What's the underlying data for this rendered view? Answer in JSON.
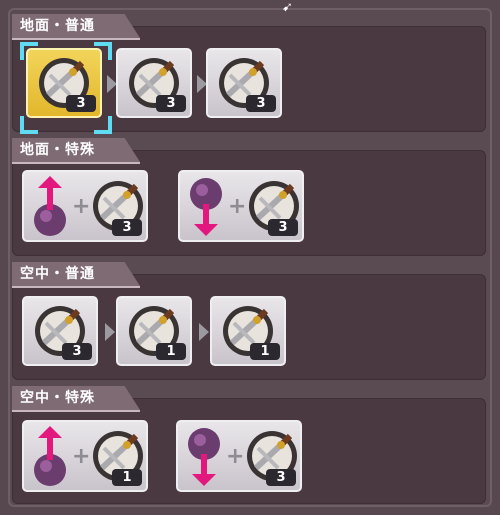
{
  "sections": [
    {
      "title": "地面・普通",
      "type": "chain",
      "items": [
        {
          "count": "3",
          "selected": true
        },
        {
          "count": "3"
        },
        {
          "count": "3"
        }
      ]
    },
    {
      "title": "地面・特殊",
      "type": "combo",
      "items": [
        {
          "direction": "up",
          "count": "3"
        },
        {
          "direction": "down",
          "count": "3"
        }
      ]
    },
    {
      "title": "空中・普通",
      "type": "chain",
      "items": [
        {
          "count": "3"
        },
        {
          "count": "1"
        },
        {
          "count": "1"
        }
      ]
    },
    {
      "title": "空中・特殊",
      "type": "combo",
      "items": [
        {
          "direction": "up",
          "count": "1"
        },
        {
          "direction": "down",
          "count": "3"
        }
      ]
    }
  ],
  "colors": {
    "selection_corner": "#5fdcf2",
    "arrow_magenta": "#e3187f",
    "selected_bg": "#f0cf4a"
  },
  "icons": {
    "attack": "sword-shield-emblem-icon",
    "chain_arrow": "triangle-right-icon",
    "plus": "plus-icon",
    "stick_up": "joystick-up-icon",
    "stick_down": "joystick-down-icon"
  }
}
